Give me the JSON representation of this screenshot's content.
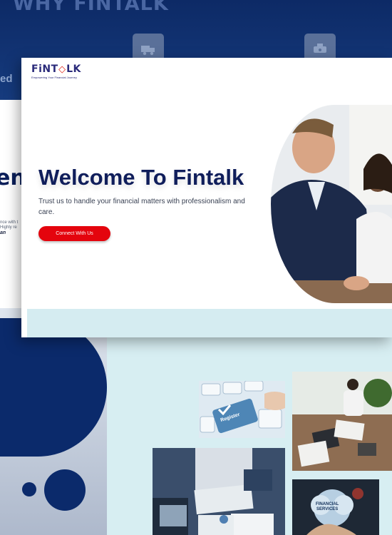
{
  "background": {
    "heading": "WHY FINTALK",
    "side_text": "ed",
    "big_fragment": "ent",
    "small_fragments": [
      "nce with t",
      "Highly re"
    ],
    "quote_name": "an",
    "icons": [
      "truck-icon",
      "delivery-icon"
    ]
  },
  "brand": {
    "name_prefix": "FiNT",
    "name_mark": "◇",
    "name_suffix": "LK",
    "tagline": "Empowering Your Financial Journey"
  },
  "hero": {
    "title": "Welcome To Fintalk",
    "subtitle": "Trust us to handle your financial matters with professionalism and care.",
    "cta_label": "Connect With Us"
  },
  "gallery": {
    "register_key_label": "Register",
    "financial_services_label_line1": "FINANCIAL",
    "financial_services_label_line2": "SERVICES"
  },
  "colors": {
    "navy": "#101e5b",
    "accent_red": "#e4040d",
    "pale_teal": "#d7eef2",
    "dark_blue": "#0d2a66"
  }
}
